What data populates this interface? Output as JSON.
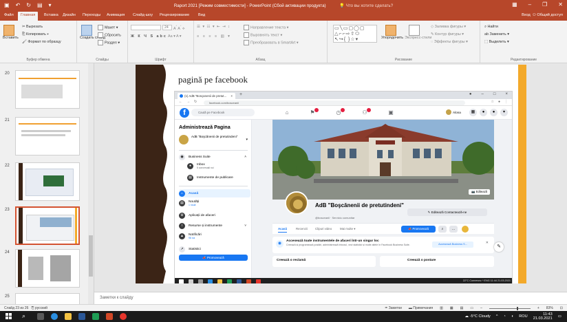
{
  "colors": {
    "accent": "#b7472a",
    "slide_brown": "#3b2416",
    "slide_orange": "#f3a92a",
    "fb_blue": "#1877f2"
  },
  "titlebar": {
    "title": "Raport 2021 [Режим совместимости] - PowerPoint (Сбой активации продукта)",
    "tell_me": "Что вы хотите сделать?",
    "qat_icons": [
      "save-icon",
      "undo-icon",
      "redo-icon",
      "present-icon"
    ],
    "controls": [
      "ribbon-display-icon",
      "minimize-icon",
      "maximize-icon",
      "close-icon"
    ]
  },
  "menu": {
    "tabs": [
      "Файл",
      "Главная",
      "Вставка",
      "Дизайн",
      "Переходы",
      "Анимация",
      "Слайд-шоу",
      "Рецензирование",
      "Вид"
    ],
    "active": "Главная",
    "signin": "Вход",
    "share": "Общий доступ"
  },
  "ribbon": {
    "clipboard": {
      "paste": "Вставить",
      "cut": "Вырезать",
      "copy": "Копировать",
      "format_painter": "Формат по образцу",
      "label": "Буфер обмена"
    },
    "slides": {
      "new_slide": "Создать слайд",
      "layout": "Макет",
      "reset": "Сбросить",
      "section": "Раздел",
      "label": "Слайды"
    },
    "font": {
      "font_name": "",
      "font_size": "24",
      "label": "Шрифт"
    },
    "paragraph": {
      "text_direction": "Направление текста",
      "align_text": "Выровнять текст",
      "smartart": "Преобразовать в SmartArt",
      "label": "Абзац"
    },
    "drawing": {
      "arrange": "Упорядочить",
      "quick_styles": "Экспресс-стили",
      "shape_fill": "Заливка фигуры",
      "shape_outline": "Контур фигуры",
      "shape_effects": "Эффекты фигуры",
      "label": "Рисование"
    },
    "editing": {
      "find": "Найти",
      "replace": "Заменить",
      "select": "Выделить",
      "label": "Редактирование"
    }
  },
  "thumbnails": [
    {
      "num": "20"
    },
    {
      "num": "21"
    },
    {
      "num": "22"
    },
    {
      "num": "23",
      "selected": true
    },
    {
      "num": "24"
    },
    {
      "num": "25"
    }
  ],
  "slide": {
    "title": "pagină pe facebook",
    "browser": {
      "tab_title": "(1) AdB \"Bosçanenii de pretut...",
      "url": "facebook.com/bosceanii"
    },
    "facebook": {
      "search_placeholder": "Caută pe Facebook",
      "user_name": "Alona",
      "manage_page": "Administrează Pagina",
      "page_short": "AdB \"Boşcănenii de pretutindeni\"",
      "business_suite": "Business Suite",
      "inbox": "Inbox",
      "inbox_sub": "5 conversații noi",
      "publishing_tools": "Instrumente de publicare",
      "home": "Acasă",
      "news": "Noutăți",
      "news_sub": "1 nouă",
      "business_apps": "Aplicații de afaceri",
      "resources": "Resurse și instrumente",
      "notifications": "Notificări",
      "notifications_sub": "98 noi",
      "stats": "Statistici",
      "promote_side": "Promovează",
      "edit_cover": "Editează",
      "page_name": "AdB \"Boşcănenii de pretutindeni\"",
      "page_sub": "@bosceanii · Serviciu comunitar",
      "edit_contact": "Editează Contactează-ne",
      "tabs": [
        "Acasă",
        "Recenzii",
        "Clipuri video",
        "Mai multe ▾"
      ],
      "promote": "Promovează",
      "card1_title": "Accesează toate instrumentele de afaceri într-un singur loc",
      "card1_desc": "Creează și programează postări, administrează Inboxul, vezi statistici și multe altele în Facebook Business Suite.",
      "card1_link": "Accesează Business S...",
      "card2_title": "Creează o reclamă",
      "card2_side": "Creează o postare"
    },
    "embedded_taskbar": {
      "tray": "22°C Солнечно  ^ ENG 11:44 21.03.2021"
    }
  },
  "notes": {
    "placeholder": "Заметки к слайду"
  },
  "status": {
    "slide_info": "Слайд 23 из 26",
    "language": "русский",
    "notes": "Заметки",
    "comments": "Примечания",
    "zoom": "83%",
    "zoom_level": 83
  },
  "win_taskbar": {
    "weather": "-5°C Cloudy",
    "lang": "ROU",
    "time": "11:43",
    "date": "21.03.2021"
  }
}
